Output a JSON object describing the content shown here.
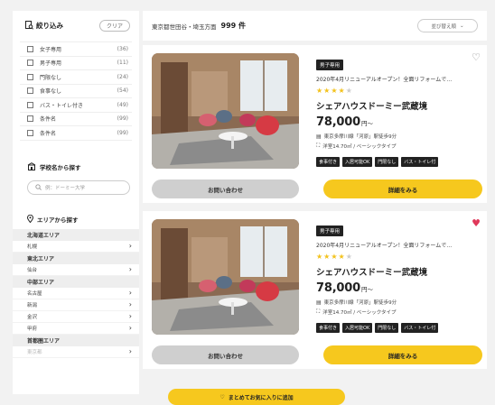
{
  "sidebar": {
    "filter_title": "絞り込み",
    "clear_label": "クリア",
    "filters": [
      {
        "label": "女子専用",
        "count": "(36)"
      },
      {
        "label": "男子専用",
        "count": "(11)"
      },
      {
        "label": "門限なし",
        "count": "(24)"
      },
      {
        "label": "食事なし",
        "count": "(54)"
      },
      {
        "label": "バス・トイレ付き",
        "count": "(49)"
      },
      {
        "label": "条件名",
        "count": "(99)"
      },
      {
        "label": "条件名",
        "count": "(99)"
      }
    ],
    "school_title": "学校名から探す",
    "school_placeholder": "例：ドーミー大学",
    "area_title": "エリアから探す",
    "areas": [
      {
        "head": "北海道エリア",
        "items": [
          "札幌"
        ]
      },
      {
        "head": "東北エリア",
        "items": [
          "仙台"
        ]
      },
      {
        "head": "中部エリア",
        "items": [
          "名古屋",
          "新潟",
          "金沢",
          "甲府"
        ]
      },
      {
        "head": "首都圏エリア",
        "items": [
          "東京都"
        ]
      }
    ]
  },
  "topbar": {
    "breadcrumb": "東京都世田谷・埼玉方面",
    "count": "999 件",
    "sort_label": "並び替え順"
  },
  "listings": [
    {
      "tag": "男子専用",
      "subtitle": "2020年4月リニューアルオープン！全面リフォームで…",
      "rating": 4,
      "max_rating": 5,
      "name": "シェアハウスドーミー武蔵境",
      "price": "78,000",
      "price_unit": "円〜",
      "location": "東京多摩川線「河原」駅徒歩9分",
      "size": "洋室14.70㎡ / ベーシックタイプ",
      "badges": [
        "食事付き",
        "入居可能OK",
        "門限なし",
        "バス・トイレ付"
      ],
      "inquiry_label": "お問い合わせ",
      "detail_label": "詳細をみる",
      "favorited": false
    },
    {
      "tag": "男子専用",
      "subtitle": "2020年4月リニューアルオープン！全面リフォームで…",
      "rating": 4,
      "max_rating": 5,
      "name": "シェアハウスドーミー武蔵境",
      "price": "78,000",
      "price_unit": "円〜",
      "location": "東京多摩川線「河原」駅徒歩9分",
      "size": "洋室14.70㎡ / ベーシックタイプ",
      "badges": [
        "食事付き",
        "入居可能OK",
        "門限なし",
        "バス・トイレ付"
      ],
      "inquiry_label": "お問い合わせ",
      "detail_label": "詳細をみる",
      "favorited": true
    }
  ],
  "footer": {
    "fav_all_label": "まとめてお気に入りに追加"
  },
  "colors": {
    "accent": "#f6c81e",
    "heart_active": "#e0385a",
    "tag_bg": "#222222"
  }
}
